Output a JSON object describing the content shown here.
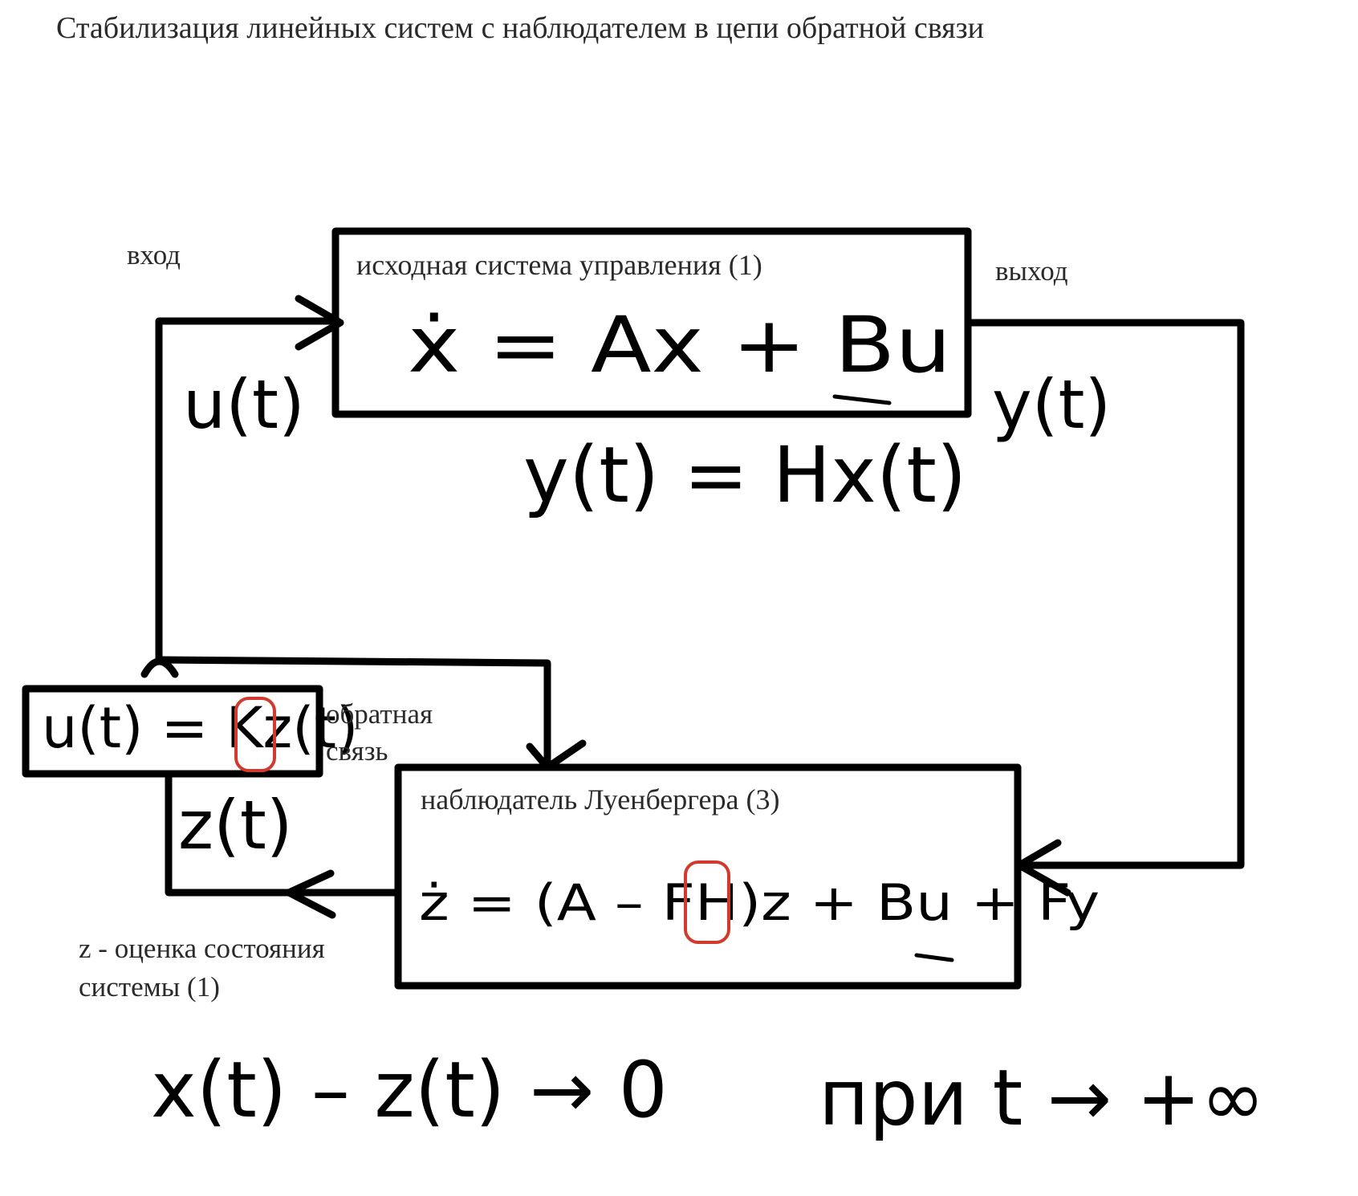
{
  "title": "Стабилизация линейных систем с наблюдателем в цепи обратной связи",
  "plant_box": {
    "label": "исходная система управления (1)",
    "equation": "ẋ = Ax + Bu"
  },
  "observer_box": {
    "label": "наблюдатель Луенбергера (3)",
    "equation": "ż = (A – FH)z + Bu + Fy"
  },
  "feedback_box": {
    "equation": "u(t) = Kz(t)"
  },
  "labels": {
    "input": "вход",
    "output": "выход",
    "feedback_line1": "обратная",
    "feedback_line2": "связь",
    "estimate_line1": "z - оценка состояния",
    "estimate_line2": "системы (1)"
  },
  "handwritten": {
    "u_signal": "u(t)",
    "y_signal": "y(t)",
    "output_equation": "y(t) = Hx(t)",
    "z_signal": "z(t)",
    "convergence": "x(t) – z(t) → 0",
    "condition": "при  t → +∞"
  },
  "colors": {
    "ink": "#000000",
    "text": "#2a2a2a",
    "highlight": "#d33a2e",
    "background": "#ffffff"
  }
}
